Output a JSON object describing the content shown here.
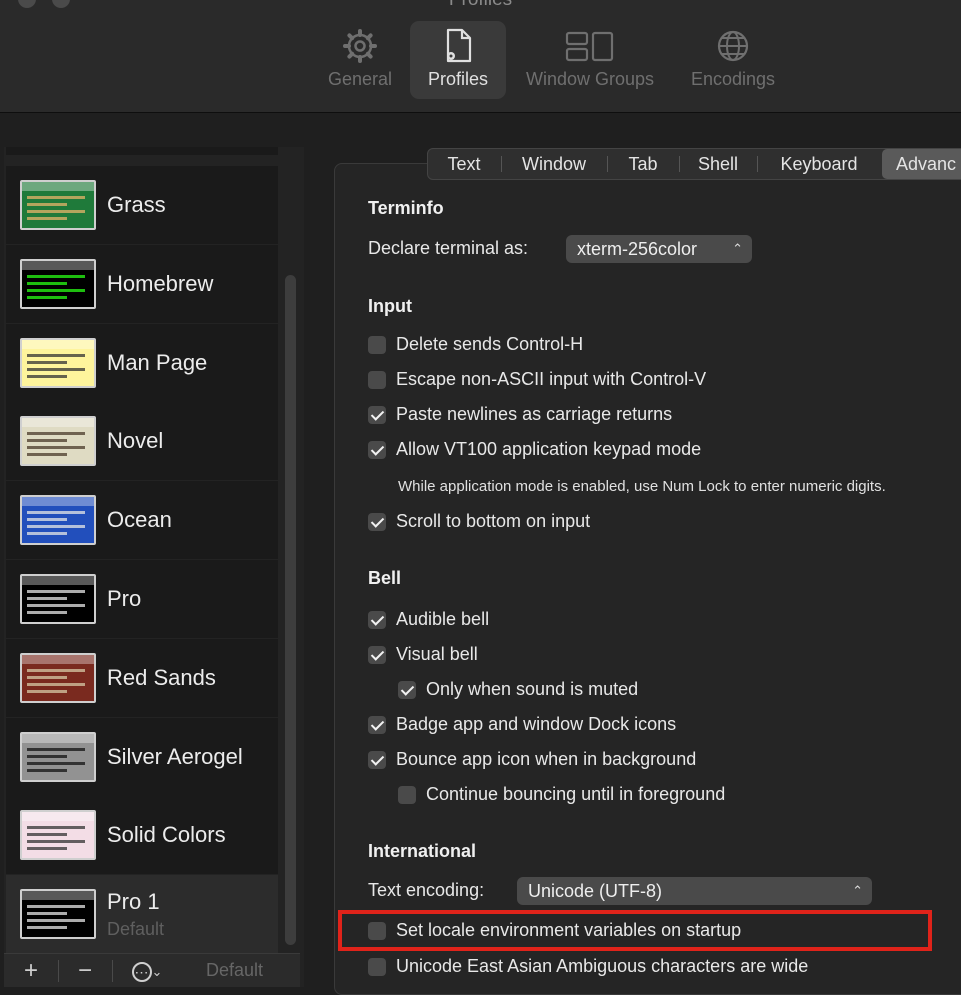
{
  "window": {
    "title": "Profiles"
  },
  "toolbar": {
    "items": [
      {
        "label": "General",
        "icon": "gear-icon"
      },
      {
        "label": "Profiles",
        "icon": "profile-doc-icon"
      },
      {
        "label": "Window Groups",
        "icon": "window-groups-icon"
      },
      {
        "label": "Encodings",
        "icon": "globe-icon"
      }
    ],
    "active": "Profiles"
  },
  "sidebar": {
    "profiles": [
      {
        "name": "Grass",
        "bg": "#1f7a3a",
        "fg": "#e6b46a"
      },
      {
        "name": "Homebrew",
        "bg": "#000000",
        "fg": "#28fe14"
      },
      {
        "name": "Man Page",
        "bg": "#fef49c",
        "fg": "#333333"
      },
      {
        "name": "Novel",
        "bg": "#dfdbc3",
        "fg": "#4a3a2a"
      },
      {
        "name": "Ocean",
        "bg": "#224fbc",
        "fg": "#e6e6e6"
      },
      {
        "name": "Pro",
        "bg": "#000000",
        "fg": "#e6e6e6"
      },
      {
        "name": "Red Sands",
        "bg": "#7a2a1f",
        "fg": "#d7c9a7"
      },
      {
        "name": "Silver Aerogel",
        "bg": "#929292",
        "fg": "#111111"
      },
      {
        "name": "Solid Colors",
        "bg": "#f3dde6",
        "fg": "#333333"
      },
      {
        "name": "Pro 1",
        "sub": "Default",
        "bg": "#000000",
        "fg": "#e6e6e6"
      }
    ],
    "bottom": {
      "add": "+",
      "remove": "−",
      "more": "⋯",
      "default": "Default"
    }
  },
  "tabs": [
    "Text",
    "Window",
    "Tab",
    "Shell",
    "Keyboard",
    "Advanc"
  ],
  "active_tab": "Advanc",
  "terminfo": {
    "heading": "Terminfo",
    "declare_label": "Declare terminal as:",
    "declare_value": "xterm-256color"
  },
  "input": {
    "heading": "Input",
    "options": [
      {
        "label": "Delete sends Control-H",
        "checked": false
      },
      {
        "label": "Escape non-ASCII input with Control-V",
        "checked": false
      },
      {
        "label": "Paste newlines as carriage returns",
        "checked": true
      },
      {
        "label": "Allow VT100 application keypad mode",
        "checked": true
      },
      {
        "label": "Scroll to bottom on input",
        "checked": true
      }
    ],
    "note": "While application mode is enabled, use Num Lock to enter numeric digits."
  },
  "bell": {
    "heading": "Bell",
    "options": [
      {
        "label": "Audible bell",
        "checked": true
      },
      {
        "label": "Visual bell",
        "checked": true
      },
      {
        "label": "Only when sound is muted",
        "checked": true
      },
      {
        "label": "Badge app and window Dock icons",
        "checked": true
      },
      {
        "label": "Bounce app icon when in background",
        "checked": true
      },
      {
        "label": "Continue bouncing until in foreground",
        "checked": false
      }
    ]
  },
  "international": {
    "heading": "International",
    "encoding_label": "Text encoding:",
    "encoding_value": "Unicode (UTF-8)",
    "options": [
      {
        "label": "Set locale environment variables on startup",
        "checked": false
      },
      {
        "label": "Unicode East Asian Ambiguous characters are wide",
        "checked": false
      }
    ]
  },
  "colors": {
    "highlight": "#e0231a",
    "background": "#1f1f1f"
  }
}
